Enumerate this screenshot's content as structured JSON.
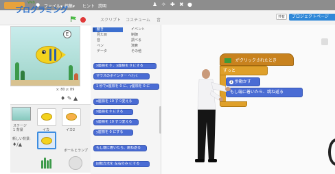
{
  "menubar": {
    "menu_items": [
      "ファイル▾",
      "編集▾",
      "ヒント",
      "説明"
    ]
  },
  "header": {
    "project_title": "プログラミング",
    "title_tag": "Web",
    "tabs": [
      "スクリプト",
      "コスチューム",
      "音"
    ],
    "share_label": "共有",
    "project_page_label": "プロジェクトページ"
  },
  "stage": {
    "speech_text": "E",
    "coords_label": "x: 80  y: 89"
  },
  "sprite_pane": {
    "stage_label": "ステージ",
    "stage_sublabel": "1 背景",
    "new_backdrop_label": "新しい背景:",
    "sprite1_label": "イカ",
    "sprite2_label": "イカ2",
    "sprite3_label": "ボールとランプ"
  },
  "palette": {
    "categories_left": [
      "動き",
      "見た目",
      "音",
      "ペン",
      "データ"
    ],
    "categories_right": [
      "イベント",
      "制御",
      "調べる",
      "演算",
      "その他"
    ],
    "blocks": [
      "x座標を 0 、y座標を 0 にする",
      "マウスのポインター へ行く",
      "1 秒でx座標を 0 に、y座標を 0 に",
      "x座標を 10 ずつ変える",
      "x座標を 0 にする",
      "y座標を 10 ずつ変える",
      "y座標を 0 にする",
      "もし端に着いたら、跳ね返る",
      "回転方法を 左右のみ にする"
    ]
  },
  "script": {
    "hat_label": "がクリックされたとき",
    "forever_label": "ずっと",
    "move_label": "歩動かす",
    "move_steps": "3",
    "bounce_label": "もし端に着いたら、跳ね返る"
  },
  "colors": {
    "motion": "#4a6cd4",
    "events": "#c8821e",
    "control": "#dfa02a",
    "accent": "#2f88d8"
  }
}
